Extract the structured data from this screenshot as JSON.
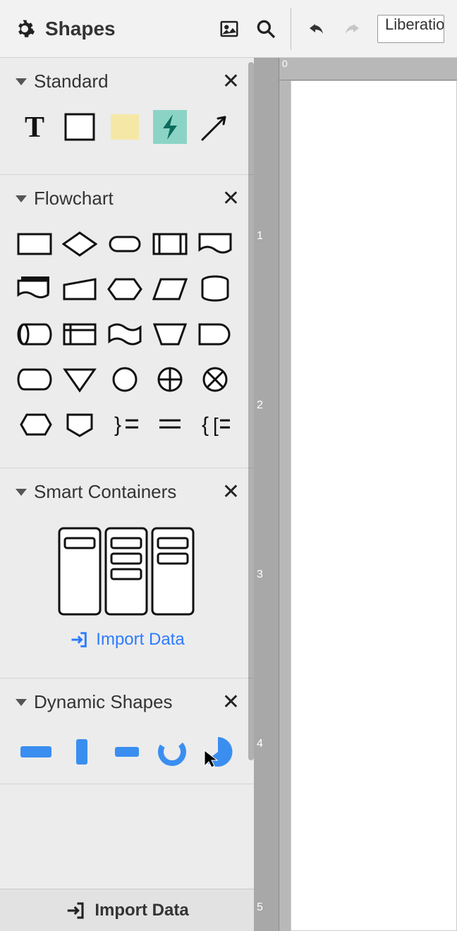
{
  "toolbar": {
    "title": "Shapes",
    "font": "Liberation"
  },
  "sections": {
    "standard": {
      "title": "Standard",
      "shapes": [
        "text",
        "rectangle",
        "sticky-note",
        "bolt",
        "arrow"
      ]
    },
    "flowchart": {
      "title": "Flowchart",
      "shapes": [
        "process",
        "decision",
        "terminator",
        "predefined-process",
        "document",
        "stack",
        "manual-input",
        "hexagon",
        "parallelogram",
        "database",
        "stored-data",
        "internal-storage",
        "wave-document",
        "manual-operation",
        "delay",
        "display",
        "merge",
        "connector",
        "summing-junction",
        "or",
        "off-page",
        "card",
        "brace-right",
        "note",
        "brace-left"
      ]
    },
    "smart": {
      "title": "Smart Containers",
      "import": "Import Data"
    },
    "dynamic": {
      "title": "Dynamic Shapes",
      "shapes": [
        "bar-h",
        "bar-v",
        "bar-short",
        "donut",
        "pie"
      ]
    }
  },
  "bottom": {
    "import": "Import Data"
  },
  "ruler": {
    "h0": "0",
    "v1": "1",
    "v2": "2",
    "v3": "3",
    "v4": "4",
    "v5": "5"
  },
  "colors": {
    "accent": "#2d7bff",
    "teal": "#8bd4c5",
    "sticky": "#f5e8a6"
  }
}
